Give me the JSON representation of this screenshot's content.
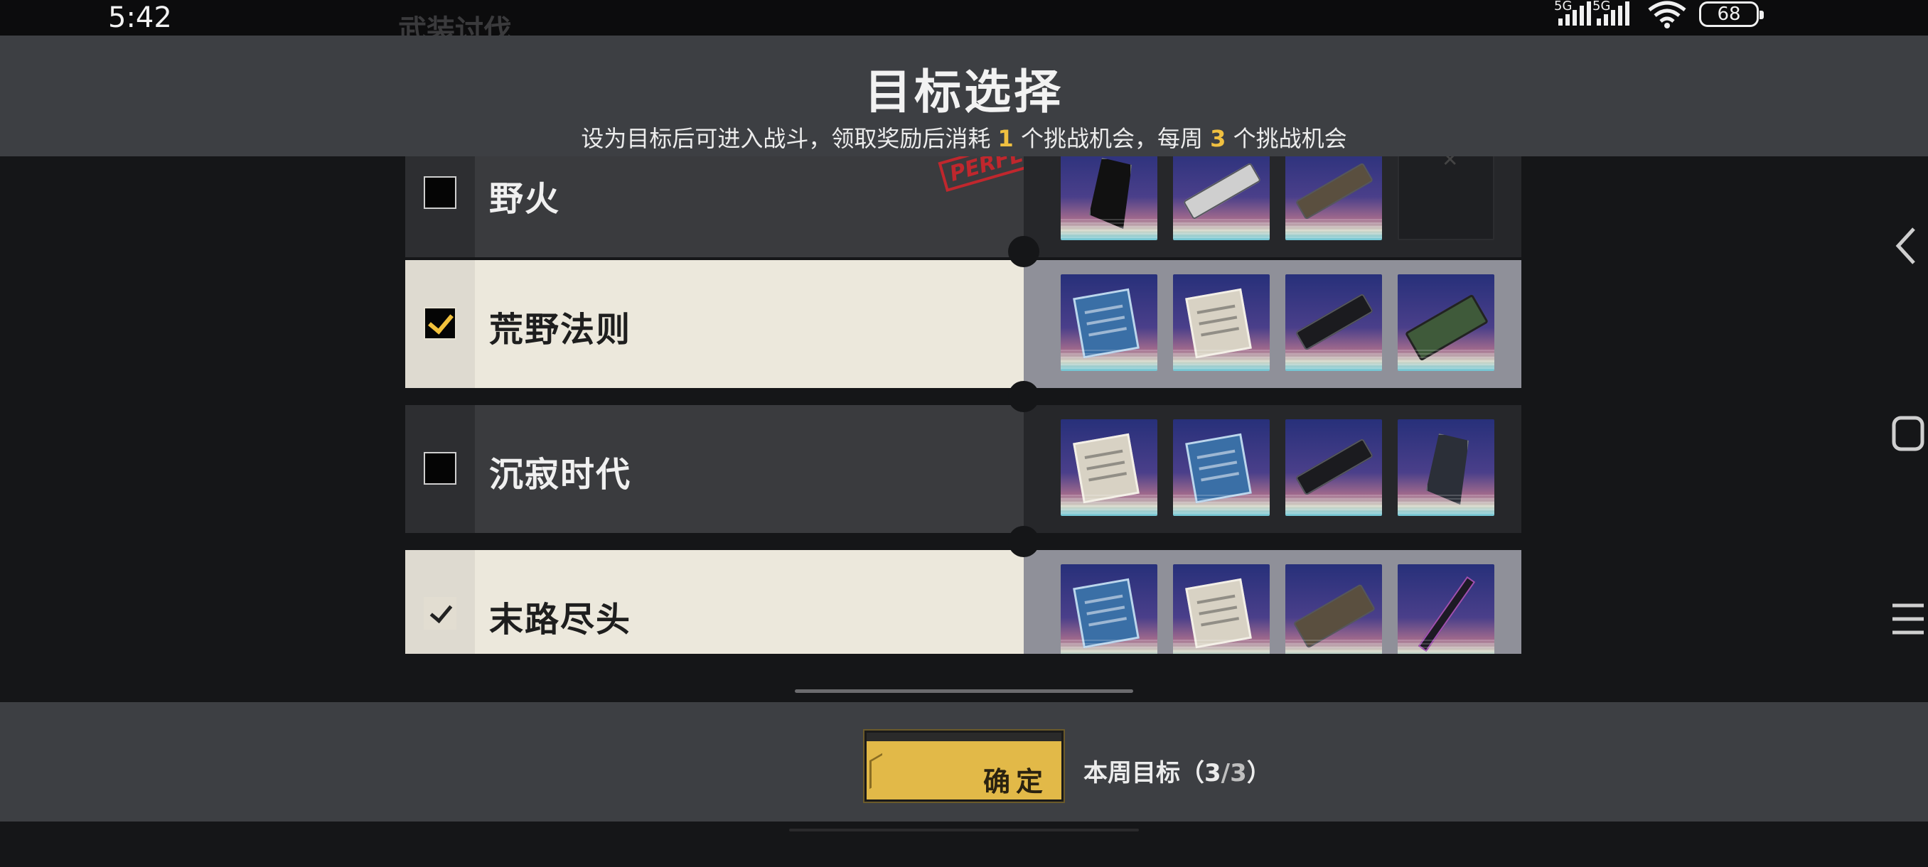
{
  "status_bar": {
    "time": "5:42",
    "network1": "5G",
    "network2": "5G",
    "battery": "68"
  },
  "background": {
    "title": "武装讨伐"
  },
  "header": {
    "title": "目标选择",
    "subtitle_pre": "设为目标后可进入战斗，领取奖励后消耗",
    "subtitle_n1": "1",
    "subtitle_mid": "个挑战机会，每周",
    "subtitle_n2": "3",
    "subtitle_post": "个挑战机会"
  },
  "rows": [
    {
      "name": "野火",
      "checked": false,
      "style": "dark",
      "stamp": "PERFECT",
      "items": [
        "black-claw-weapon",
        "white-gun",
        "tan-tank",
        "empty-slot"
      ]
    },
    {
      "name": "荒野法则",
      "checked": true,
      "style": "light",
      "items": [
        "blue-blueprint",
        "white-blueprint",
        "black-rifle",
        "green-launcher"
      ]
    },
    {
      "name": "沉寂时代",
      "checked": false,
      "style": "dark",
      "items": [
        "white-blueprint",
        "blue-blueprint",
        "black-gun",
        "dark-shield"
      ]
    },
    {
      "name": "末路尽头",
      "checked": true,
      "style": "light",
      "items": [
        "blue-blueprint",
        "white-blueprint",
        "tan-cannon",
        "purple-sword"
      ]
    }
  ],
  "footer": {
    "confirm_label": "确定",
    "goal_label": "本周目标",
    "goal_open": "（",
    "goal_current": "3",
    "goal_sep": "/",
    "goal_total": "3",
    "goal_close": "）"
  },
  "colors": {
    "accent": "#f0c040",
    "header_bg": "#3d3f43",
    "row_light": "#ece8dc",
    "row_dark": "#3a3b3e"
  }
}
